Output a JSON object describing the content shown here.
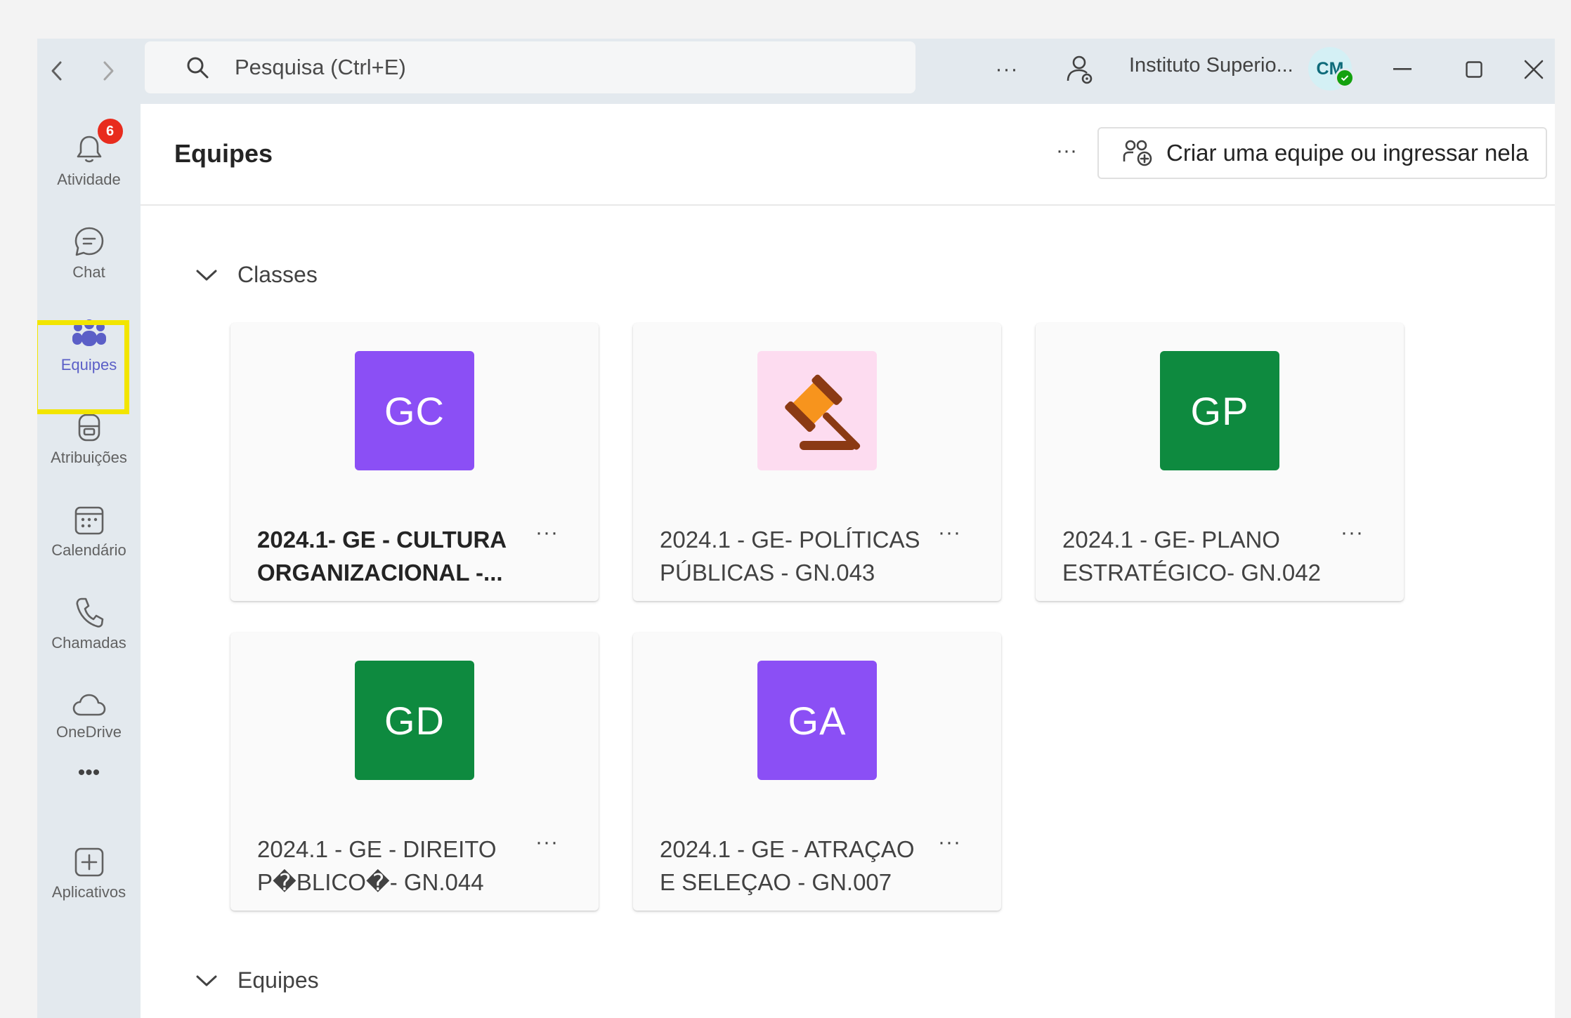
{
  "titlebar": {
    "search_placeholder": "Pesquisa (Ctrl+E)",
    "more": "···",
    "org_name": "Instituto Superio...",
    "avatar_initials": "CM"
  },
  "rail": {
    "items": [
      {
        "label": "Atividade",
        "icon": "bell-icon",
        "badge": "6"
      },
      {
        "label": "Chat",
        "icon": "chat-icon"
      },
      {
        "label": "Equipes",
        "icon": "teams-icon",
        "active": true
      },
      {
        "label": "Atribuições",
        "icon": "backpack-icon"
      },
      {
        "label": "Calendário",
        "icon": "calendar-icon"
      },
      {
        "label": "Chamadas",
        "icon": "phone-icon"
      },
      {
        "label": "OneDrive",
        "icon": "cloud-icon"
      },
      {
        "label": "",
        "icon": "more-icon"
      },
      {
        "label": "Aplicativos",
        "icon": "apps-icon"
      }
    ],
    "more": "•••"
  },
  "main": {
    "title": "Equipes",
    "more": "···",
    "create_button": "Criar uma equipe ou ingressar nela",
    "sections": [
      {
        "label": "Classes"
      },
      {
        "label": "Equipes"
      }
    ],
    "teams": [
      {
        "initials": "GC",
        "color": "#8b4ff5",
        "name_line1": "2024.1- GE - CULTURA",
        "name_line2": "ORGANIZACIONAL -...",
        "bold": true
      },
      {
        "initials": "",
        "color": "#fddcf0",
        "icon": "gavel-icon",
        "name_line1": "2024.1 - GE- POLÍTICAS",
        "name_line2": "PÚBLICAS - GN.043"
      },
      {
        "initials": "GP",
        "color": "#0e8a3f",
        "name_line1": "2024.1 - GE- PLANO",
        "name_line2": "ESTRATÉGICO- GN.042"
      },
      {
        "initials": "GD",
        "color": "#0e8a3f",
        "name_line1": "2024.1 - GE - DIREITO",
        "name_line2": "P�BLICO�- GN.044"
      },
      {
        "initials": "GA",
        "color": "#8b4ff5",
        "name_line1": "2024.1 - GE - ATRAÇAO",
        "name_line2": "E SELEÇAO - GN.007"
      }
    ],
    "card_more": "···"
  }
}
